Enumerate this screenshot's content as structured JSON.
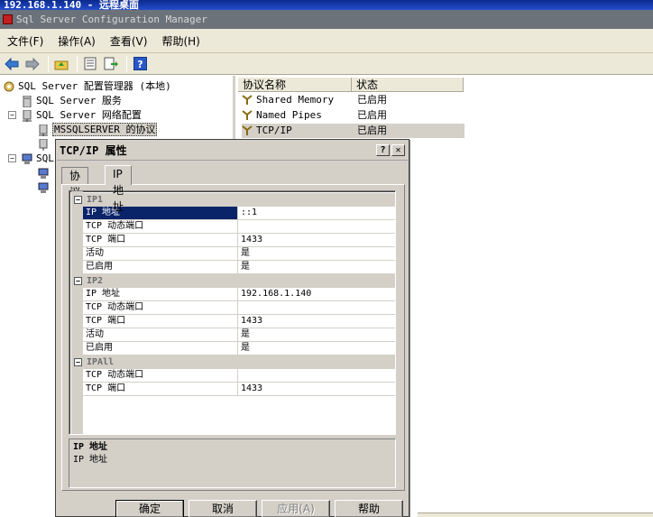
{
  "rdp_title": "192.168.1.140 - 远程桌面",
  "window_title": "Sql Server Configuration Manager",
  "menu": [
    "文件(F)",
    "操作(A)",
    "查看(V)",
    "帮助(H)"
  ],
  "tree": {
    "root": "SQL Server 配置管理器 (本地)",
    "services": "SQL Server 服务",
    "network_config": "SQL Server 网络配置",
    "protocols": "MSSQLSERVER 的协议",
    "native_client_partial": "SQL"
  },
  "list": {
    "headers": [
      "协议名称",
      "状态"
    ],
    "rows": [
      {
        "name": "Shared Memory",
        "status": "已启用"
      },
      {
        "name": "Named Pipes",
        "status": "已启用"
      },
      {
        "name": "TCP/IP",
        "status": "已启用"
      }
    ]
  },
  "dialog": {
    "title": "TCP/IP 属性",
    "help_btn": "?",
    "close_btn": "✕",
    "tabs": [
      "协议",
      "IP 地址"
    ],
    "groups": [
      {
        "name": "IP1",
        "rows": [
          {
            "k": "IP 地址",
            "v": "::1"
          },
          {
            "k": "TCP 动态端口",
            "v": ""
          },
          {
            "k": "TCP 端口",
            "v": "1433"
          },
          {
            "k": "活动",
            "v": "是"
          },
          {
            "k": "已启用",
            "v": "是"
          }
        ]
      },
      {
        "name": "IP2",
        "rows": [
          {
            "k": "IP 地址",
            "v": "192.168.1.140"
          },
          {
            "k": "TCP 动态端口",
            "v": ""
          },
          {
            "k": "TCP 端口",
            "v": "1433"
          },
          {
            "k": "活动",
            "v": "是"
          },
          {
            "k": "已启用",
            "v": "是"
          }
        ]
      },
      {
        "name": "IPAll",
        "rows": [
          {
            "k": "TCP 动态端口",
            "v": ""
          },
          {
            "k": "TCP 端口",
            "v": "1433"
          }
        ]
      }
    ],
    "desc_title": "IP 地址",
    "desc_text": "IP 地址",
    "buttons": {
      "ok": "确定",
      "cancel": "取消",
      "apply": "应用(A)",
      "help": "帮助"
    }
  },
  "colors": {
    "selection": "#0a246a",
    "dialog_bg": "#d4d0c8",
    "rdp_bar": "#1a3ba8"
  }
}
